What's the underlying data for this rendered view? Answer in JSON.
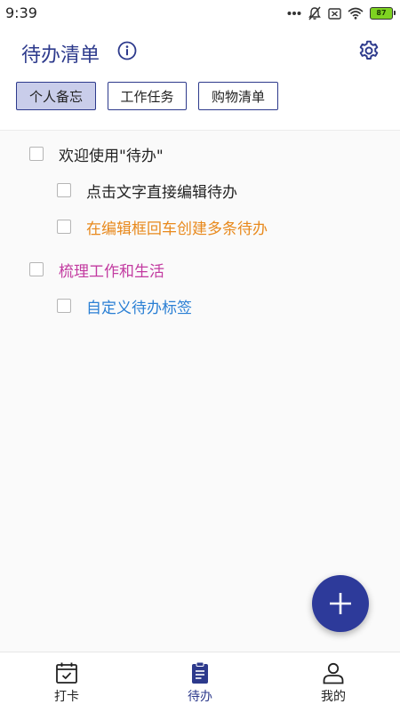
{
  "status_bar": {
    "time": "9:39",
    "battery": "87",
    "icons": [
      "more-dots-icon",
      "notifications-off-icon",
      "sim-off-icon",
      "wifi-icon",
      "battery-icon"
    ]
  },
  "header": {
    "title": "待办清单",
    "info_icon": "info-icon",
    "settings_icon": "gear-icon"
  },
  "tabs": [
    {
      "label": "个人备忘",
      "active": true
    },
    {
      "label": "工作任务",
      "active": false
    },
    {
      "label": "购物清单",
      "active": false
    }
  ],
  "todos": [
    {
      "text": "欢迎使用\"待办\"",
      "level": 0,
      "checked": false,
      "color": "#222222"
    },
    {
      "text": "点击文字直接编辑待办",
      "level": 1,
      "checked": false,
      "color": "#222222"
    },
    {
      "text": "在编辑框回车创建多条待办",
      "level": 1,
      "checked": false,
      "color": "#e8891c"
    },
    {
      "text": "梳理工作和生活",
      "level": 0,
      "checked": false,
      "color": "#c23aa0"
    },
    {
      "text": "自定义待办标签",
      "level": 1,
      "checked": false,
      "color": "#2a7fd4"
    }
  ],
  "fab": {
    "icon": "plus-icon"
  },
  "bottom_nav": [
    {
      "label": "打卡",
      "icon": "calendar-check-icon",
      "active": false
    },
    {
      "label": "待办",
      "icon": "clipboard-icon",
      "active": true
    },
    {
      "label": "我的",
      "icon": "person-icon",
      "active": false
    }
  ],
  "colors": {
    "primary": "#2d3a8c",
    "tab_active_bg": "#c9cdea",
    "fab": "#2d3a9a"
  }
}
